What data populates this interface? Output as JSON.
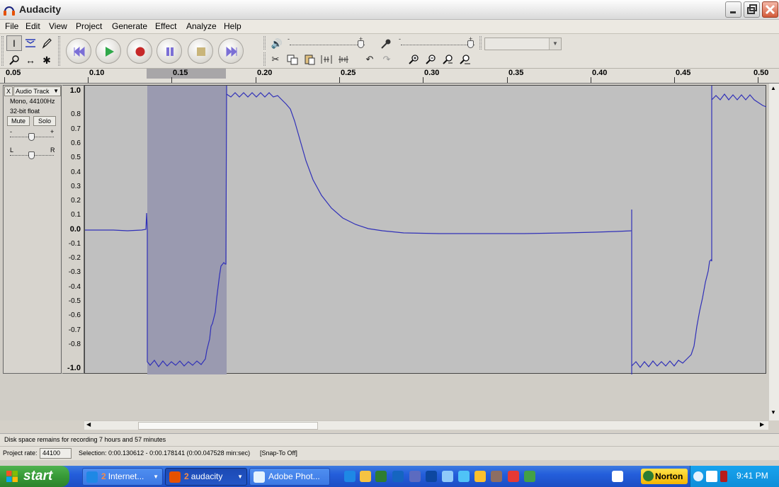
{
  "window": {
    "title": "Audacity"
  },
  "menu": [
    "File",
    "Edit",
    "View",
    "Project",
    "Generate",
    "Effect",
    "Analyze",
    "Help"
  ],
  "icons": {
    "app": "audacity-headphones-icon",
    "minimize": "minimize-icon",
    "maximize": "maximize-icon",
    "close": "close-icon",
    "tools": [
      "selection-tool-icon",
      "envelope-tool-icon",
      "draw-tool-icon",
      "zoom-tool-icon",
      "timeshift-tool-icon",
      "multi-tool-icon"
    ],
    "transport": [
      "skip-start-icon",
      "play-icon",
      "record-icon",
      "pause-icon",
      "stop-icon",
      "skip-end-icon"
    ],
    "edit": [
      "cut-icon",
      "copy-icon",
      "paste-icon",
      "trim-icon",
      "silence-icon",
      "undo-icon",
      "redo-icon",
      "zoom-in-icon",
      "zoom-out-icon",
      "fit-selection-icon",
      "fit-project-icon"
    ]
  },
  "colors": {
    "waveform": "#3030b8",
    "selection": "#9a9ab0",
    "background": "#c0c0c0",
    "taskbar": "#245edb",
    "start": "#379a37"
  },
  "ruler": {
    "labels": [
      "0.05",
      "0.10",
      "0.15",
      "0.20",
      "0.25",
      "0.30",
      "0.35",
      "0.40",
      "0.45",
      "0.50"
    ]
  },
  "track": {
    "name": "Audio Track",
    "format_line1": "Mono, 44100Hz",
    "format_line2": "32-bit float",
    "mute": "Mute",
    "solo": "Solo",
    "gain_minus": "-",
    "gain_plus": "+",
    "pan_left": "L",
    "pan_right": "R",
    "close_glyph": "X"
  },
  "amplitude_labels": [
    "1.0",
    "0.8",
    "0.7",
    "0.6",
    "0.5",
    "0.4",
    "0.3",
    "0.2",
    "0.1",
    "0.0",
    "-0.1",
    "-0.2",
    "-0.3",
    "-0.4",
    "-0.5",
    "-0.6",
    "-0.7",
    "-0.8",
    "-1.0"
  ],
  "status": {
    "disk": "Disk space remains for recording 7 hours and 57 minutes",
    "rate_label": "Project rate:",
    "rate_value": "44100",
    "selection": "Selection: 0:00.130612 - 0:00.178141 (0:00.047528 min:sec)",
    "snap": "[Snap-To Off]"
  },
  "taskbar": {
    "start": "start",
    "items": [
      {
        "num": "2",
        "label": "Internet...",
        "icon": "ie-icon"
      },
      {
        "num": "2",
        "label": "audacity",
        "icon": "audacity-icon"
      },
      {
        "num": "",
        "label": "Adobe Phot...",
        "icon": "photoshop-icon"
      }
    ],
    "norton": "Norton",
    "clock": "9:41 PM"
  }
}
